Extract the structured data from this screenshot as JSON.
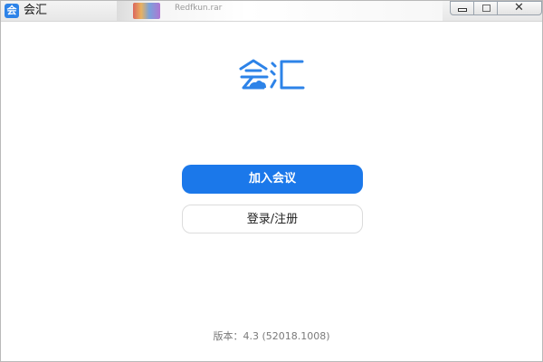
{
  "window": {
    "title": "会汇",
    "app_icon_glyph": "会",
    "background_app_label": "Redfkun.rar"
  },
  "window_controls": {
    "minimize_icon": "minimize-icon",
    "maximize_icon": "maximize-icon",
    "close_glyph": "✕"
  },
  "logo": {
    "text": "会汇",
    "color": "#2d83e8"
  },
  "actions": {
    "join_label": "加入会议",
    "login_label": "登录/注册"
  },
  "footer": {
    "version_text": "版本：4.3 (52018.1008)"
  },
  "colors": {
    "primary": "#1b78ea",
    "logo_blue": "#2d83e8"
  }
}
